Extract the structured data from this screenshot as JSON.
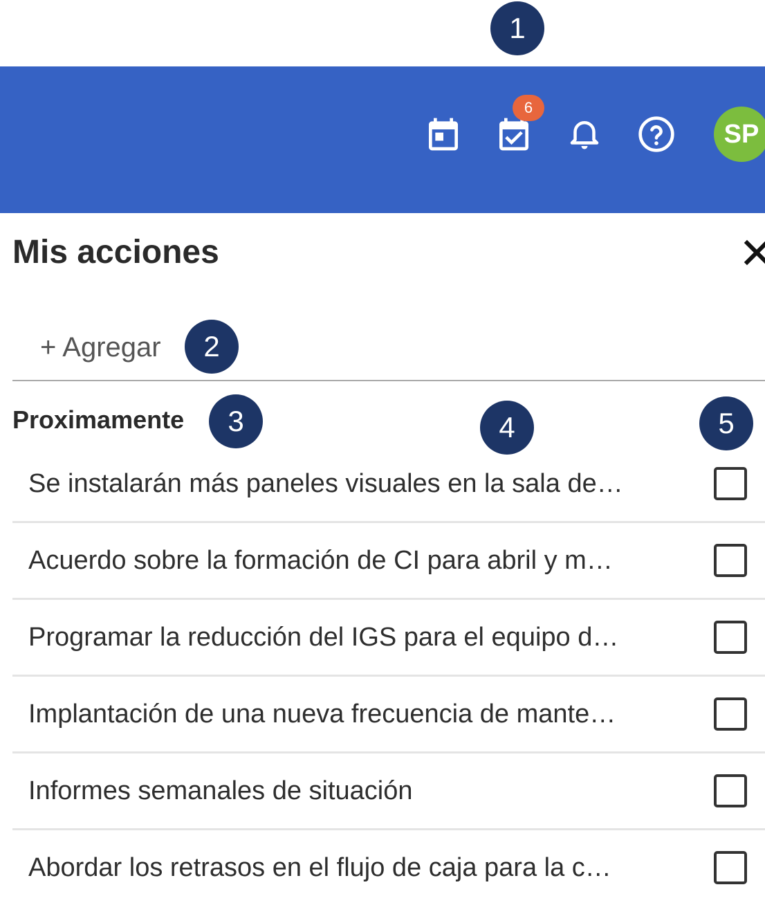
{
  "callouts": [
    "1",
    "2",
    "3",
    "4",
    "5"
  ],
  "topbar": {
    "icons": [
      "calendar-icon",
      "tasks-icon",
      "bell-icon",
      "help-icon"
    ],
    "tasks_badge": "6",
    "avatar_initials": "SP",
    "colors": {
      "bar": "#3662c4",
      "badge": "#e8663d",
      "avatar": "#7cbd3e"
    }
  },
  "panel": {
    "title": "Mis acciones",
    "add_label": "+ Agregar",
    "section_heading": "Proximamente",
    "items": [
      {
        "text": "Se instalarán más paneles visuales en la sala de…",
        "checked": false
      },
      {
        "text": "Acuerdo sobre la formación de CI para abril y m…",
        "checked": false
      },
      {
        "text": "Programar la reducción del IGS para el equipo d…",
        "checked": false
      },
      {
        "text": "Implantación de una nueva frecuencia de mante…",
        "checked": false
      },
      {
        "text": "Informes semanales de situación",
        "checked": false
      },
      {
        "text": "Abordar los retrasos en el flujo de caja para la c…",
        "checked": false
      }
    ]
  }
}
